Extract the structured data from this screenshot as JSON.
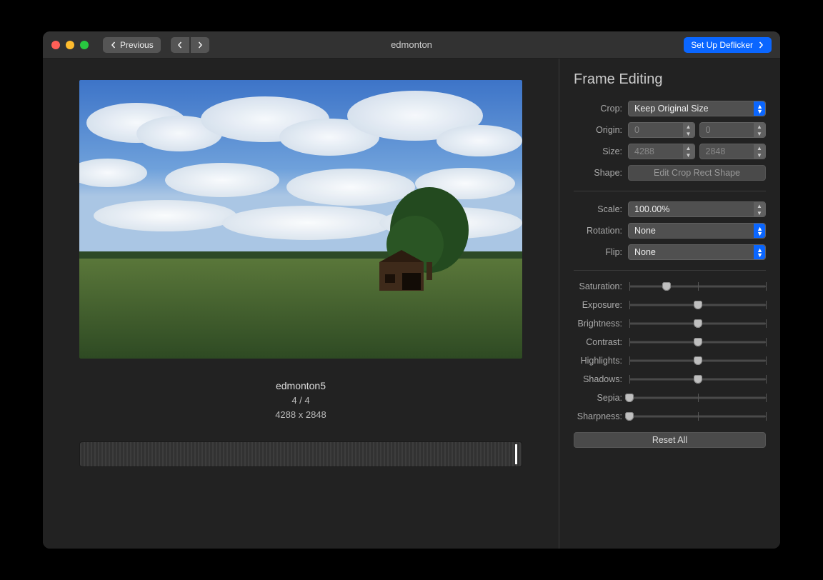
{
  "titlebar": {
    "previous_label": "Previous",
    "title": "edmonton",
    "setup_label": "Set Up Deflicker"
  },
  "preview": {
    "filename": "edmonton5",
    "index": "4 / 4",
    "dimensions": "4288 x 2848"
  },
  "panel": {
    "title": "Frame Editing",
    "crop_label": "Crop:",
    "crop_value": "Keep Original Size",
    "origin_label": "Origin:",
    "origin_x": "0",
    "origin_y": "0",
    "size_label": "Size:",
    "size_w": "4288",
    "size_h": "2848",
    "shape_label": "Shape:",
    "shape_button": "Edit Crop Rect Shape",
    "scale_label": "Scale:",
    "scale_value": "100.00%",
    "rotation_label": "Rotation:",
    "rotation_value": "None",
    "flip_label": "Flip:",
    "flip_value": "None",
    "sliders": [
      {
        "label": "Saturation:",
        "pos": 27
      },
      {
        "label": "Exposure:",
        "pos": 50
      },
      {
        "label": "Brightness:",
        "pos": 50
      },
      {
        "label": "Contrast:",
        "pos": 50
      },
      {
        "label": "Highlights:",
        "pos": 50
      },
      {
        "label": "Shadows:",
        "pos": 50
      },
      {
        "label": "Sepia:",
        "pos": 0
      },
      {
        "label": "Sharpness:",
        "pos": 0
      }
    ],
    "reset_label": "Reset All"
  }
}
